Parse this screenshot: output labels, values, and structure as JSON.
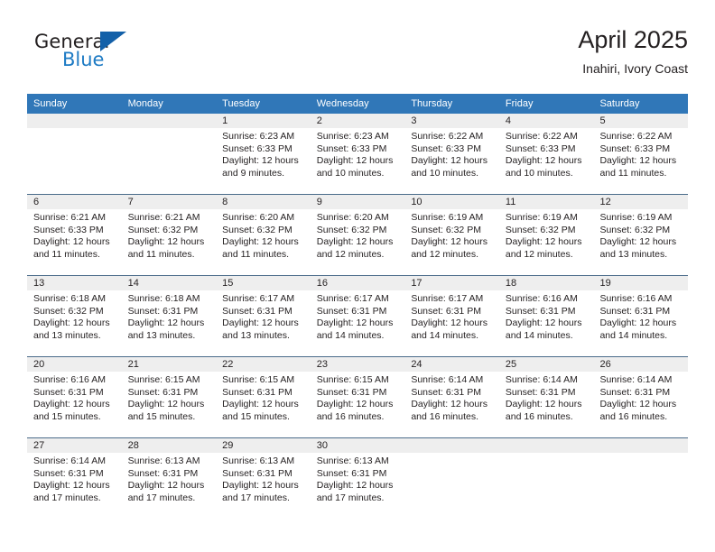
{
  "brand": {
    "name_part1": "General",
    "name_part2": "Blue",
    "logo_icon": "triangle-logo-icon",
    "accent_color": "#1360a8",
    "text_color": "#1e7bc4"
  },
  "header": {
    "title": "April 2025",
    "subtitle": "Inahiri, Ivory Coast"
  },
  "calendar": {
    "header_color": "#3077b8",
    "datebar_color": "#eeeeee",
    "weekdays": [
      "Sunday",
      "Monday",
      "Tuesday",
      "Wednesday",
      "Thursday",
      "Friday",
      "Saturday"
    ],
    "weeks": [
      {
        "days": [
          {
            "num": "",
            "lines": []
          },
          {
            "num": "",
            "lines": []
          },
          {
            "num": "1",
            "lines": [
              "Sunrise: 6:23 AM",
              "Sunset: 6:33 PM",
              "Daylight: 12 hours",
              "and 9 minutes."
            ]
          },
          {
            "num": "2",
            "lines": [
              "Sunrise: 6:23 AM",
              "Sunset: 6:33 PM",
              "Daylight: 12 hours",
              "and 10 minutes."
            ]
          },
          {
            "num": "3",
            "lines": [
              "Sunrise: 6:22 AM",
              "Sunset: 6:33 PM",
              "Daylight: 12 hours",
              "and 10 minutes."
            ]
          },
          {
            "num": "4",
            "lines": [
              "Sunrise: 6:22 AM",
              "Sunset: 6:33 PM",
              "Daylight: 12 hours",
              "and 10 minutes."
            ]
          },
          {
            "num": "5",
            "lines": [
              "Sunrise: 6:22 AM",
              "Sunset: 6:33 PM",
              "Daylight: 12 hours",
              "and 11 minutes."
            ]
          }
        ]
      },
      {
        "days": [
          {
            "num": "6",
            "lines": [
              "Sunrise: 6:21 AM",
              "Sunset: 6:33 PM",
              "Daylight: 12 hours",
              "and 11 minutes."
            ]
          },
          {
            "num": "7",
            "lines": [
              "Sunrise: 6:21 AM",
              "Sunset: 6:32 PM",
              "Daylight: 12 hours",
              "and 11 minutes."
            ]
          },
          {
            "num": "8",
            "lines": [
              "Sunrise: 6:20 AM",
              "Sunset: 6:32 PM",
              "Daylight: 12 hours",
              "and 11 minutes."
            ]
          },
          {
            "num": "9",
            "lines": [
              "Sunrise: 6:20 AM",
              "Sunset: 6:32 PM",
              "Daylight: 12 hours",
              "and 12 minutes."
            ]
          },
          {
            "num": "10",
            "lines": [
              "Sunrise: 6:19 AM",
              "Sunset: 6:32 PM",
              "Daylight: 12 hours",
              "and 12 minutes."
            ]
          },
          {
            "num": "11",
            "lines": [
              "Sunrise: 6:19 AM",
              "Sunset: 6:32 PM",
              "Daylight: 12 hours",
              "and 12 minutes."
            ]
          },
          {
            "num": "12",
            "lines": [
              "Sunrise: 6:19 AM",
              "Sunset: 6:32 PM",
              "Daylight: 12 hours",
              "and 13 minutes."
            ]
          }
        ]
      },
      {
        "days": [
          {
            "num": "13",
            "lines": [
              "Sunrise: 6:18 AM",
              "Sunset: 6:32 PM",
              "Daylight: 12 hours",
              "and 13 minutes."
            ]
          },
          {
            "num": "14",
            "lines": [
              "Sunrise: 6:18 AM",
              "Sunset: 6:31 PM",
              "Daylight: 12 hours",
              "and 13 minutes."
            ]
          },
          {
            "num": "15",
            "lines": [
              "Sunrise: 6:17 AM",
              "Sunset: 6:31 PM",
              "Daylight: 12 hours",
              "and 13 minutes."
            ]
          },
          {
            "num": "16",
            "lines": [
              "Sunrise: 6:17 AM",
              "Sunset: 6:31 PM",
              "Daylight: 12 hours",
              "and 14 minutes."
            ]
          },
          {
            "num": "17",
            "lines": [
              "Sunrise: 6:17 AM",
              "Sunset: 6:31 PM",
              "Daylight: 12 hours",
              "and 14 minutes."
            ]
          },
          {
            "num": "18",
            "lines": [
              "Sunrise: 6:16 AM",
              "Sunset: 6:31 PM",
              "Daylight: 12 hours",
              "and 14 minutes."
            ]
          },
          {
            "num": "19",
            "lines": [
              "Sunrise: 6:16 AM",
              "Sunset: 6:31 PM",
              "Daylight: 12 hours",
              "and 14 minutes."
            ]
          }
        ]
      },
      {
        "days": [
          {
            "num": "20",
            "lines": [
              "Sunrise: 6:16 AM",
              "Sunset: 6:31 PM",
              "Daylight: 12 hours",
              "and 15 minutes."
            ]
          },
          {
            "num": "21",
            "lines": [
              "Sunrise: 6:15 AM",
              "Sunset: 6:31 PM",
              "Daylight: 12 hours",
              "and 15 minutes."
            ]
          },
          {
            "num": "22",
            "lines": [
              "Sunrise: 6:15 AM",
              "Sunset: 6:31 PM",
              "Daylight: 12 hours",
              "and 15 minutes."
            ]
          },
          {
            "num": "23",
            "lines": [
              "Sunrise: 6:15 AM",
              "Sunset: 6:31 PM",
              "Daylight: 12 hours",
              "and 16 minutes."
            ]
          },
          {
            "num": "24",
            "lines": [
              "Sunrise: 6:14 AM",
              "Sunset: 6:31 PM",
              "Daylight: 12 hours",
              "and 16 minutes."
            ]
          },
          {
            "num": "25",
            "lines": [
              "Sunrise: 6:14 AM",
              "Sunset: 6:31 PM",
              "Daylight: 12 hours",
              "and 16 minutes."
            ]
          },
          {
            "num": "26",
            "lines": [
              "Sunrise: 6:14 AM",
              "Sunset: 6:31 PM",
              "Daylight: 12 hours",
              "and 16 minutes."
            ]
          }
        ]
      },
      {
        "days": [
          {
            "num": "27",
            "lines": [
              "Sunrise: 6:14 AM",
              "Sunset: 6:31 PM",
              "Daylight: 12 hours",
              "and 17 minutes."
            ]
          },
          {
            "num": "28",
            "lines": [
              "Sunrise: 6:13 AM",
              "Sunset: 6:31 PM",
              "Daylight: 12 hours",
              "and 17 minutes."
            ]
          },
          {
            "num": "29",
            "lines": [
              "Sunrise: 6:13 AM",
              "Sunset: 6:31 PM",
              "Daylight: 12 hours",
              "and 17 minutes."
            ]
          },
          {
            "num": "30",
            "lines": [
              "Sunrise: 6:13 AM",
              "Sunset: 6:31 PM",
              "Daylight: 12 hours",
              "and 17 minutes."
            ]
          },
          {
            "num": "",
            "lines": []
          },
          {
            "num": "",
            "lines": []
          },
          {
            "num": "",
            "lines": []
          }
        ]
      }
    ]
  }
}
